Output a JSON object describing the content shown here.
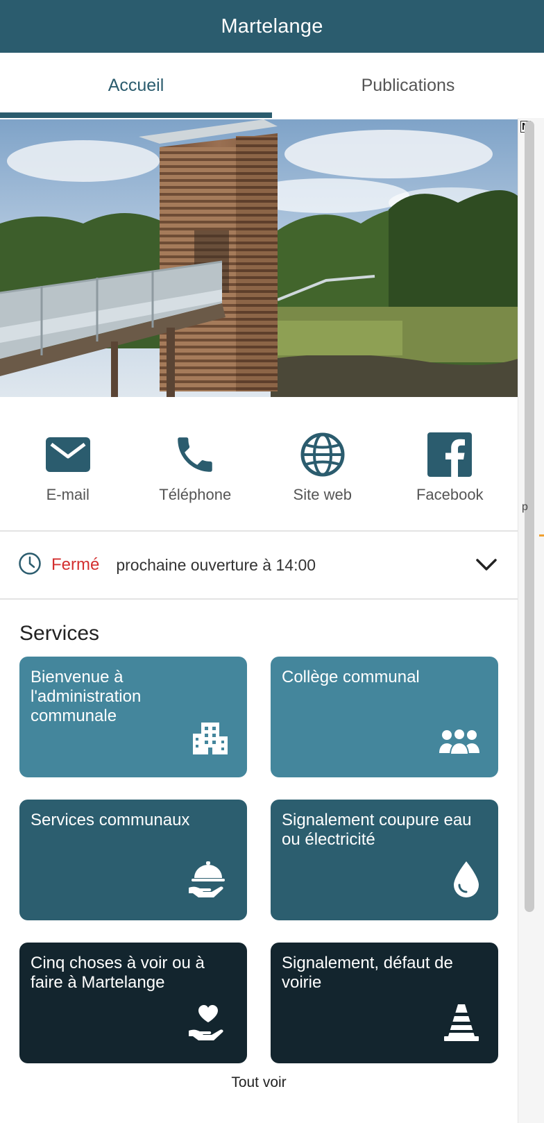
{
  "header": {
    "title": "Martelange"
  },
  "tabs": [
    {
      "label": "Accueil",
      "active": true
    },
    {
      "label": "Publications",
      "active": false
    }
  ],
  "hero": {
    "image": "wooden-observation-tower-with-footbridge-photo"
  },
  "contacts": [
    {
      "label": "E-mail",
      "icon": "mail-icon"
    },
    {
      "label": "Téléphone",
      "icon": "phone-icon"
    },
    {
      "label": "Site web",
      "icon": "globe-icon"
    },
    {
      "label": "Facebook",
      "icon": "facebook-icon"
    }
  ],
  "hours": {
    "status": "Fermé",
    "next": "prochaine ouverture à 14:00",
    "status_color": "#d32f2f"
  },
  "services": {
    "title": "Services",
    "cards": [
      {
        "label": "Bienvenue à l'administration communale",
        "icon": "city-buildings-icon",
        "color": "#44869c"
      },
      {
        "label": "Collège communal",
        "icon": "group-users-icon",
        "color": "#44869c"
      },
      {
        "label": "Services communaux",
        "icon": "service-bell-hand-icon",
        "color": "#2c5e6f"
      },
      {
        "label": "Signalement coupure eau ou électricité",
        "icon": "water-drop-icon",
        "color": "#2c5e6f"
      },
      {
        "label": "Cinq choses à voir ou à faire à Martelange",
        "icon": "hand-heart-icon",
        "color": "#13252e"
      },
      {
        "label": "Signalement, défaut de voirie",
        "icon": "traffic-cone-icon",
        "color": "#13252e"
      }
    ],
    "see_all": "Tout voir"
  },
  "colors": {
    "brand": "#2b5c6e",
    "card_light": "#44869c",
    "card_mid": "#2c5e6f",
    "card_dark": "#13252e"
  },
  "side_panel": {
    "top_label": "N",
    "mid_label": "p"
  }
}
